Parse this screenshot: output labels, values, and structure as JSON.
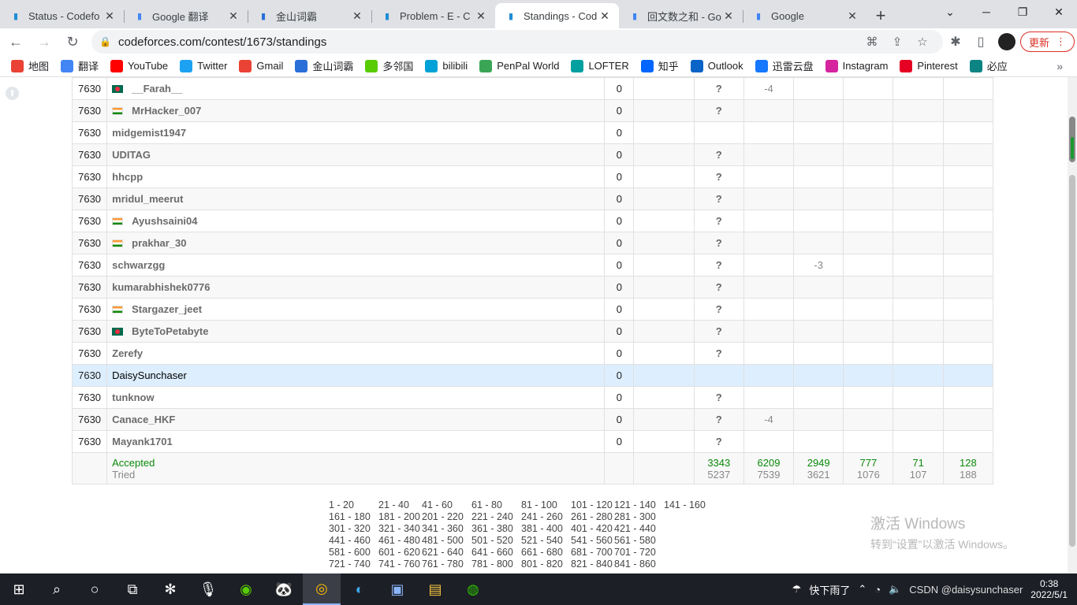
{
  "browser": {
    "tabs": [
      {
        "title": "Status - Codefo",
        "icon": "codeforces-icon",
        "color": "#1f8dd6"
      },
      {
        "title": "Google 翻译",
        "icon": "google-translate-icon",
        "color": "#4285f4"
      },
      {
        "title": "金山词霸",
        "icon": "iciba-icon",
        "color": "#2a6fd8"
      },
      {
        "title": "Problem - E - C",
        "icon": "codeforces-icon",
        "color": "#1f8dd6"
      },
      {
        "title": "Standings - Cod",
        "icon": "codeforces-icon",
        "color": "#1f8dd6",
        "active": true
      },
      {
        "title": "回文数之和 - Go",
        "icon": "google-icon",
        "color": "#4285f4"
      },
      {
        "title": "Google",
        "icon": "google-icon",
        "color": "#4285f4"
      }
    ],
    "new_tab": "+",
    "url": "codeforces.com/contest/1673/standings",
    "update_label": "更新",
    "bookmarks": [
      {
        "label": "地图",
        "icon": "map-pin-icon",
        "color": "#ea4335"
      },
      {
        "label": "翻译",
        "icon": "google-translate-icon",
        "color": "#4285f4"
      },
      {
        "label": "YouTube",
        "icon": "youtube-icon",
        "color": "#ff0000"
      },
      {
        "label": "Twitter",
        "icon": "twitter-icon",
        "color": "#1da1f2"
      },
      {
        "label": "Gmail",
        "icon": "gmail-icon",
        "color": "#ea4335"
      },
      {
        "label": "金山词霸",
        "icon": "iciba-icon",
        "color": "#2a6fd8"
      },
      {
        "label": "多邻国",
        "icon": "duolingo-icon",
        "color": "#58cc02"
      },
      {
        "label": "bilibili",
        "icon": "bilibili-icon",
        "color": "#00a1d6"
      },
      {
        "label": "PenPal World",
        "icon": "penpal-icon",
        "color": "#3aa655"
      },
      {
        "label": "LOFTER",
        "icon": "lofter-icon",
        "color": "#00a0a0"
      },
      {
        "label": "知乎",
        "icon": "zhihu-icon",
        "color": "#0066ff"
      },
      {
        "label": "Outlook",
        "icon": "outlook-icon",
        "color": "#0a64c8"
      },
      {
        "label": "迅雷云盘",
        "icon": "xunlei-icon",
        "color": "#1677ff"
      },
      {
        "label": "Instagram",
        "icon": "instagram-icon",
        "color": "#d6249f"
      },
      {
        "label": "Pinterest",
        "icon": "pinterest-icon",
        "color": "#e60023"
      },
      {
        "label": "必应",
        "icon": "bing-icon",
        "color": "#0c8484"
      }
    ]
  },
  "standings": {
    "rows": [
      {
        "rank": "7630",
        "name": "__Farah__",
        "flag": "bd",
        "points": "0",
        "a": "?",
        "b": "-4",
        "c": "",
        "d": "",
        "e": "",
        "f": ""
      },
      {
        "rank": "7630",
        "name": "MrHacker_007",
        "flag": "in",
        "points": "0",
        "a": "?",
        "b": "",
        "c": "",
        "d": "",
        "e": "",
        "f": ""
      },
      {
        "rank": "7630",
        "name": "midgemist1947",
        "flag": "",
        "points": "0",
        "a": "",
        "b": "",
        "c": "",
        "d": "",
        "e": "",
        "f": ""
      },
      {
        "rank": "7630",
        "name": "UDITAG",
        "flag": "",
        "points": "0",
        "a": "?",
        "b": "",
        "c": "",
        "d": "",
        "e": "",
        "f": ""
      },
      {
        "rank": "7630",
        "name": "hhcpp",
        "flag": "",
        "points": "0",
        "a": "?",
        "b": "",
        "c": "",
        "d": "",
        "e": "",
        "f": ""
      },
      {
        "rank": "7630",
        "name": "mridul_meerut",
        "flag": "",
        "points": "0",
        "a": "?",
        "b": "",
        "c": "",
        "d": "",
        "e": "",
        "f": ""
      },
      {
        "rank": "7630",
        "name": "Ayushsaini04",
        "flag": "in",
        "points": "0",
        "a": "?",
        "b": "",
        "c": "",
        "d": "",
        "e": "",
        "f": ""
      },
      {
        "rank": "7630",
        "name": "prakhar_30",
        "flag": "in",
        "points": "0",
        "a": "?",
        "b": "",
        "c": "",
        "d": "",
        "e": "",
        "f": ""
      },
      {
        "rank": "7630",
        "name": "schwarzgg",
        "flag": "",
        "points": "0",
        "a": "?",
        "b": "",
        "c": "-3",
        "d": "",
        "e": "",
        "f": ""
      },
      {
        "rank": "7630",
        "name": "kumarabhishek0776",
        "flag": "",
        "points": "0",
        "a": "?",
        "b": "",
        "c": "",
        "d": "",
        "e": "",
        "f": ""
      },
      {
        "rank": "7630",
        "name": "Stargazer_jeet",
        "flag": "in",
        "points": "0",
        "a": "?",
        "b": "",
        "c": "",
        "d": "",
        "e": "",
        "f": ""
      },
      {
        "rank": "7630",
        "name": "ByteToPetabyte",
        "flag": "bd",
        "points": "0",
        "a": "?",
        "b": "",
        "c": "",
        "d": "",
        "e": "",
        "f": ""
      },
      {
        "rank": "7630",
        "name": "Zerefy",
        "flag": "",
        "points": "0",
        "a": "?",
        "b": "",
        "c": "",
        "d": "",
        "e": "",
        "f": ""
      },
      {
        "rank": "7630",
        "name": "DaisySunchaser",
        "flag": "",
        "points": "0",
        "a": "",
        "b": "",
        "c": "",
        "d": "",
        "e": "",
        "f": "",
        "highlight": true
      },
      {
        "rank": "7630",
        "name": "tunknow",
        "flag": "",
        "points": "0",
        "a": "?",
        "b": "",
        "c": "",
        "d": "",
        "e": "",
        "f": ""
      },
      {
        "rank": "7630",
        "name": "Canace_HKF",
        "flag": "",
        "points": "0",
        "a": "?",
        "b": "-4",
        "c": "",
        "d": "",
        "e": "",
        "f": ""
      },
      {
        "rank": "7630",
        "name": "Mayank1701",
        "flag": "",
        "points": "0",
        "a": "?",
        "b": "",
        "c": "",
        "d": "",
        "e": "",
        "f": ""
      }
    ],
    "summary": {
      "accepted_label": "Accepted",
      "tried_label": "Tried",
      "accepted": [
        "3343",
        "6209",
        "2949",
        "777",
        "71",
        "128"
      ],
      "tried": [
        "5237",
        "7539",
        "3621",
        "1076",
        "107",
        "188"
      ]
    }
  },
  "pager": [
    [
      "1 - 20",
      "21 - 40",
      "41 - 60",
      "61 - 80",
      "81 - 100",
      "101 - 120",
      "121 - 140",
      "141 - 160"
    ],
    [
      "161 - 180",
      "181 - 200",
      "201 - 220",
      "221 - 240",
      "241 - 260",
      "261 - 280",
      "281 - 300"
    ],
    [
      "301 - 320",
      "321 - 340",
      "341 - 360",
      "361 - 380",
      "381 - 400",
      "401 - 420",
      "421 - 440"
    ],
    [
      "441 - 460",
      "461 - 480",
      "481 - 500",
      "501 - 520",
      "521 - 540",
      "541 - 560",
      "561 - 580"
    ],
    [
      "581 - 600",
      "601 - 620",
      "621 - 640",
      "641 - 660",
      "661 - 680",
      "681 - 700",
      "701 - 720"
    ],
    [
      "721 - 740",
      "741 - 760",
      "761 - 780",
      "781 - 800",
      "801 - 820",
      "821 - 840",
      "841 - 860"
    ]
  ],
  "watermark": {
    "line1": "激活 Windows",
    "line2": "转到“设置”以激活 Windows。"
  },
  "taskbar": {
    "weather": "快下雨了",
    "time": "0:38",
    "date": "2022/5/1",
    "overlay": "CSDN @daisysunchaser"
  }
}
